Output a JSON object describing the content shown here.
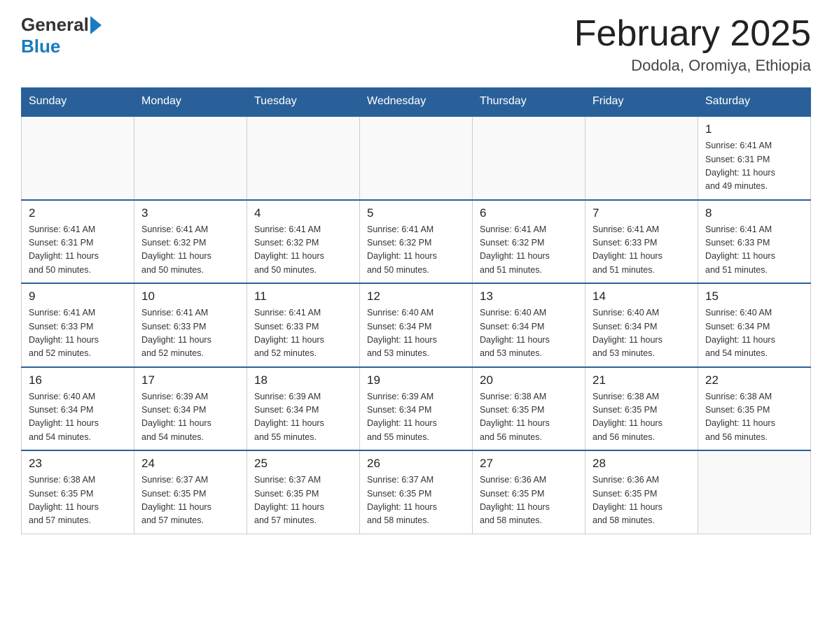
{
  "header": {
    "logo_general": "General",
    "logo_blue": "Blue",
    "month_title": "February 2025",
    "location": "Dodola, Oromiya, Ethiopia"
  },
  "weekdays": [
    "Sunday",
    "Monday",
    "Tuesday",
    "Wednesday",
    "Thursday",
    "Friday",
    "Saturday"
  ],
  "weeks": [
    [
      {
        "day": "",
        "info": ""
      },
      {
        "day": "",
        "info": ""
      },
      {
        "day": "",
        "info": ""
      },
      {
        "day": "",
        "info": ""
      },
      {
        "day": "",
        "info": ""
      },
      {
        "day": "",
        "info": ""
      },
      {
        "day": "1",
        "info": "Sunrise: 6:41 AM\nSunset: 6:31 PM\nDaylight: 11 hours\nand 49 minutes."
      }
    ],
    [
      {
        "day": "2",
        "info": "Sunrise: 6:41 AM\nSunset: 6:31 PM\nDaylight: 11 hours\nand 50 minutes."
      },
      {
        "day": "3",
        "info": "Sunrise: 6:41 AM\nSunset: 6:32 PM\nDaylight: 11 hours\nand 50 minutes."
      },
      {
        "day": "4",
        "info": "Sunrise: 6:41 AM\nSunset: 6:32 PM\nDaylight: 11 hours\nand 50 minutes."
      },
      {
        "day": "5",
        "info": "Sunrise: 6:41 AM\nSunset: 6:32 PM\nDaylight: 11 hours\nand 50 minutes."
      },
      {
        "day": "6",
        "info": "Sunrise: 6:41 AM\nSunset: 6:32 PM\nDaylight: 11 hours\nand 51 minutes."
      },
      {
        "day": "7",
        "info": "Sunrise: 6:41 AM\nSunset: 6:33 PM\nDaylight: 11 hours\nand 51 minutes."
      },
      {
        "day": "8",
        "info": "Sunrise: 6:41 AM\nSunset: 6:33 PM\nDaylight: 11 hours\nand 51 minutes."
      }
    ],
    [
      {
        "day": "9",
        "info": "Sunrise: 6:41 AM\nSunset: 6:33 PM\nDaylight: 11 hours\nand 52 minutes."
      },
      {
        "day": "10",
        "info": "Sunrise: 6:41 AM\nSunset: 6:33 PM\nDaylight: 11 hours\nand 52 minutes."
      },
      {
        "day": "11",
        "info": "Sunrise: 6:41 AM\nSunset: 6:33 PM\nDaylight: 11 hours\nand 52 minutes."
      },
      {
        "day": "12",
        "info": "Sunrise: 6:40 AM\nSunset: 6:34 PM\nDaylight: 11 hours\nand 53 minutes."
      },
      {
        "day": "13",
        "info": "Sunrise: 6:40 AM\nSunset: 6:34 PM\nDaylight: 11 hours\nand 53 minutes."
      },
      {
        "day": "14",
        "info": "Sunrise: 6:40 AM\nSunset: 6:34 PM\nDaylight: 11 hours\nand 53 minutes."
      },
      {
        "day": "15",
        "info": "Sunrise: 6:40 AM\nSunset: 6:34 PM\nDaylight: 11 hours\nand 54 minutes."
      }
    ],
    [
      {
        "day": "16",
        "info": "Sunrise: 6:40 AM\nSunset: 6:34 PM\nDaylight: 11 hours\nand 54 minutes."
      },
      {
        "day": "17",
        "info": "Sunrise: 6:39 AM\nSunset: 6:34 PM\nDaylight: 11 hours\nand 54 minutes."
      },
      {
        "day": "18",
        "info": "Sunrise: 6:39 AM\nSunset: 6:34 PM\nDaylight: 11 hours\nand 55 minutes."
      },
      {
        "day": "19",
        "info": "Sunrise: 6:39 AM\nSunset: 6:34 PM\nDaylight: 11 hours\nand 55 minutes."
      },
      {
        "day": "20",
        "info": "Sunrise: 6:38 AM\nSunset: 6:35 PM\nDaylight: 11 hours\nand 56 minutes."
      },
      {
        "day": "21",
        "info": "Sunrise: 6:38 AM\nSunset: 6:35 PM\nDaylight: 11 hours\nand 56 minutes."
      },
      {
        "day": "22",
        "info": "Sunrise: 6:38 AM\nSunset: 6:35 PM\nDaylight: 11 hours\nand 56 minutes."
      }
    ],
    [
      {
        "day": "23",
        "info": "Sunrise: 6:38 AM\nSunset: 6:35 PM\nDaylight: 11 hours\nand 57 minutes."
      },
      {
        "day": "24",
        "info": "Sunrise: 6:37 AM\nSunset: 6:35 PM\nDaylight: 11 hours\nand 57 minutes."
      },
      {
        "day": "25",
        "info": "Sunrise: 6:37 AM\nSunset: 6:35 PM\nDaylight: 11 hours\nand 57 minutes."
      },
      {
        "day": "26",
        "info": "Sunrise: 6:37 AM\nSunset: 6:35 PM\nDaylight: 11 hours\nand 58 minutes."
      },
      {
        "day": "27",
        "info": "Sunrise: 6:36 AM\nSunset: 6:35 PM\nDaylight: 11 hours\nand 58 minutes."
      },
      {
        "day": "28",
        "info": "Sunrise: 6:36 AM\nSunset: 6:35 PM\nDaylight: 11 hours\nand 58 minutes."
      },
      {
        "day": "",
        "info": ""
      }
    ]
  ]
}
